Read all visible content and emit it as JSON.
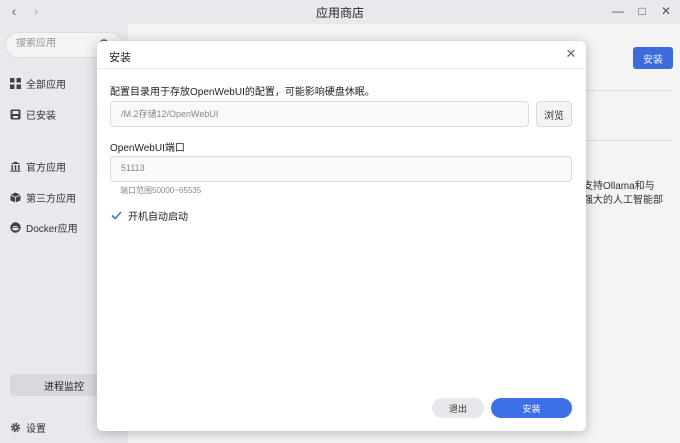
{
  "window": {
    "title": "应用商店",
    "back_icon": "chevron-left-icon",
    "forward_icon": "chevron-right-icon"
  },
  "sidebar": {
    "search_placeholder": "搜索应用",
    "items": [
      {
        "label": "全部应用",
        "icon": "grid-icon"
      },
      {
        "label": "已安装",
        "icon": "installed-icon"
      },
      {
        "label": "官方应用",
        "icon": "building-icon"
      },
      {
        "label": "第三方应用",
        "icon": "box-icon"
      },
      {
        "label": "Docker应用",
        "icon": "docker-icon"
      }
    ],
    "monitor_label": "进程监控",
    "settings_label": "设置"
  },
  "background": {
    "install_label": "安装",
    "text_line1": "支持Ollama和与",
    "text_line2": "强大的人工智能部"
  },
  "dialog": {
    "title": "安装",
    "config_label": "配置目录用于存放OpenWebUI的配置，可能影响硬盘休眠。",
    "path_value": "/M.2存储12/OpenWebUI",
    "browse_label": "浏览",
    "port_label": "OpenWebUI端口",
    "port_value": "51113",
    "port_hint": "端口范围50000~65535",
    "autostart_label": "开机自动启动",
    "autostart_checked": true,
    "cancel_label": "退出",
    "install_label": "安装"
  },
  "colors": {
    "accent": "#3d6fe6",
    "sidebar_bg": "#f3f4f7"
  }
}
